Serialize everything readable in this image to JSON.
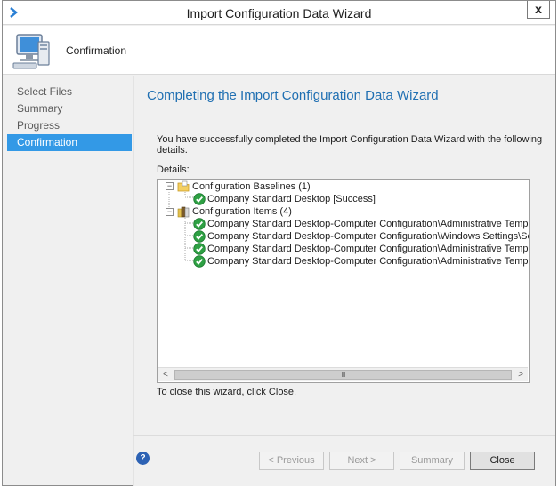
{
  "window": {
    "title": "Import Configuration Data Wizard",
    "close_glyph": "x"
  },
  "header": {
    "step_title": "Confirmation"
  },
  "nav": {
    "items": [
      {
        "label": "Select Files"
      },
      {
        "label": "Summary"
      },
      {
        "label": "Progress"
      },
      {
        "label": "Confirmation",
        "active": true
      }
    ]
  },
  "main": {
    "heading": "Completing the Import Configuration Data Wizard",
    "success_message": "You have successfully completed the Import Configuration Data Wizard with the following details.",
    "details_label": "Details:",
    "tree": {
      "baselines": {
        "label": "Configuration Baselines (1)",
        "children": [
          "Company Standard Desktop [Success]"
        ]
      },
      "items": {
        "label": "Configuration Items (4)",
        "children": [
          "Company Standard Desktop-Computer Configuration\\Administrative Templates\\System\\P",
          "Company Standard Desktop-Computer Configuration\\Windows Settings\\Security Settings",
          "Company Standard Desktop-Computer Configuration\\Administrative Templates\\Windows",
          "Company Standard Desktop-Computer Configuration\\Administrative Templates\\System\\L"
        ]
      },
      "expander_glyph": "−",
      "scroll_thumb_glyph": "III",
      "scroll_left_glyph": "<",
      "scroll_right_glyph": ">"
    },
    "close_hint": "To close this wizard, click Close."
  },
  "footer": {
    "help_glyph": "?",
    "previous_label": "< Previous",
    "next_label": "Next >",
    "summary_label": "Summary",
    "close_label": "Close"
  },
  "colors": {
    "accent": "#3399e6",
    "heading": "#1f6fb2",
    "success": "#2ea043"
  }
}
